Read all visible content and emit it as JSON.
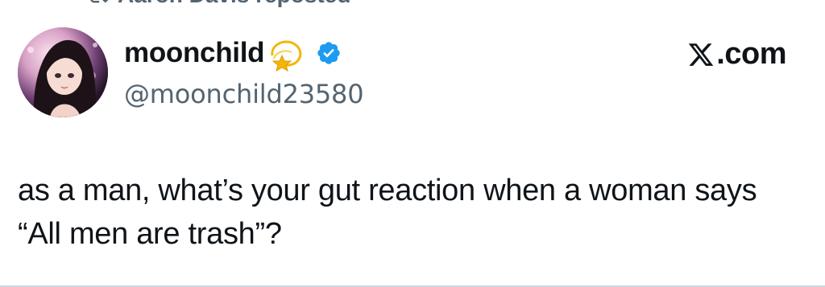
{
  "repost": {
    "icon": "repost-icon",
    "text": "Aaron Davis reposted"
  },
  "author": {
    "display_name": "moonchild",
    "name_emoji": "dizzy-emoji-icon",
    "verified_icon": "verified-badge-icon",
    "handle": "@moonchild23580",
    "avatar": "avatar"
  },
  "brand": {
    "text": ".com",
    "icon": "x-logo-icon"
  },
  "tweet": {
    "text": "as a man, what’s your gut reaction when a woman says “All men are trash”?"
  },
  "colors": {
    "primary_text": "#0f1419",
    "secondary_text": "#536471",
    "verified_blue": "#1d9bf0",
    "divider": "#cfd9de"
  }
}
